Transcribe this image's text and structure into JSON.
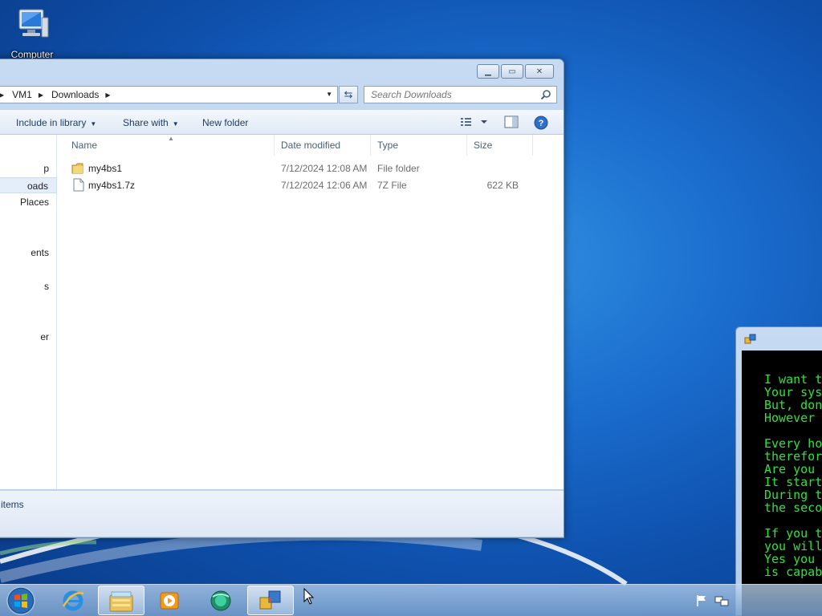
{
  "desktop": {
    "icons": [
      {
        "label": "Computer",
        "icon": "computer-icon"
      }
    ]
  },
  "explorer": {
    "address": {
      "segments": [
        "VM1",
        "Downloads"
      ]
    },
    "search": {
      "placeholder": "Search Downloads"
    },
    "toolbar": {
      "include_library": "Include in library",
      "share_with": "Share with",
      "new_folder": "New folder"
    },
    "nav_items": [
      {
        "label": "p",
        "selected": false
      },
      {
        "label": "oads",
        "selected": true
      },
      {
        "label": "Places",
        "selected": false
      },
      {
        "label": "ents",
        "selected": false
      },
      {
        "label": "s",
        "selected": false
      },
      {
        "label": "er",
        "selected": false
      }
    ],
    "columns": {
      "name": "Name",
      "date": "Date modified",
      "type": "Type",
      "size": "Size"
    },
    "files": [
      {
        "name": "my4bs1",
        "date": "7/12/2024 12:08 AM",
        "type": "File folder",
        "size": "",
        "icon": "folder-icon"
      },
      {
        "name": "my4bs1.7z",
        "date": "7/12/2024 12:06 AM",
        "type": "7Z File",
        "size": "622 KB",
        "icon": "file-icon"
      }
    ],
    "status": "items"
  },
  "console": {
    "lines": [
      "I want t",
      "Your sys",
      "But, don",
      "However",
      "",
      "Every ho",
      "therefor",
      "Are you",
      "It start",
      "During t",
      "the seco",
      "",
      "If you t",
      "you will",
      "Yes you",
      "is capab"
    ],
    "text_color": "#2fe33b"
  },
  "taskbar": {
    "items": [
      {
        "name": "internet-explorer",
        "icon": "ie-icon",
        "active": false
      },
      {
        "name": "windows-explorer",
        "icon": "folder-library-icon",
        "active": true
      },
      {
        "name": "media-player",
        "icon": "media-player-icon",
        "active": false
      },
      {
        "name": "app-green",
        "icon": "green-app-icon",
        "active": false
      },
      {
        "name": "console-app",
        "icon": "app-window-icon",
        "active": true
      }
    ]
  }
}
